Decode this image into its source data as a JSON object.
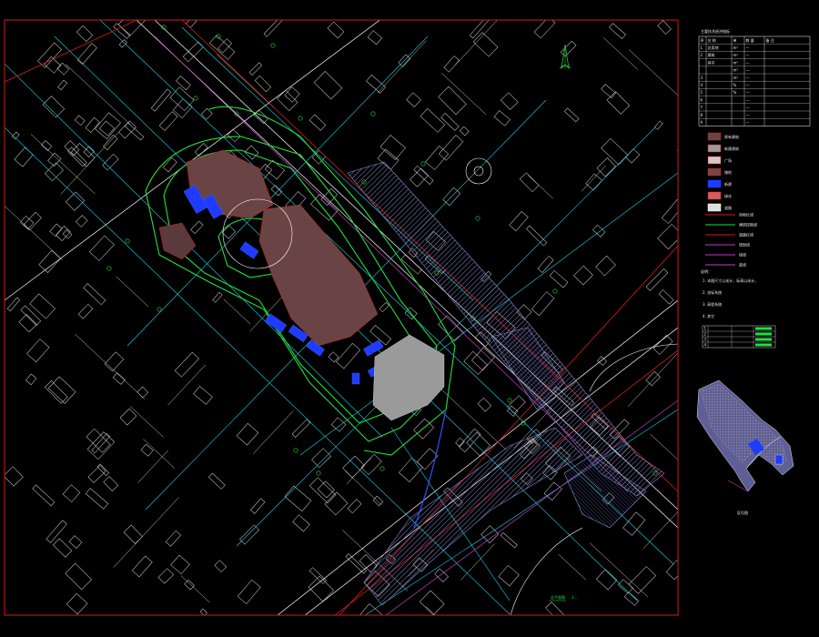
{
  "drawing": {
    "background": "#000000",
    "frame_color": "#d01c1c",
    "colors": {
      "building_lines": "#ffffff",
      "road_lines": "#ffffff",
      "cyan_grid": "#19d3e8",
      "green_boundary": "#20e040",
      "existing_building_fill": "#6a4444",
      "new_building_fill": "#1f3bff",
      "plaza_fill": "#9a9a9a",
      "hatch_color": "#7a7ab8",
      "magenta_line": "#c040c0",
      "red_line": "#d01c1c",
      "north_arrow": "#20c040"
    },
    "north_arrow_icon": "north-arrow-icon",
    "main_plan_title": "总平面图",
    "main_plan_scale": "1:...",
    "inset_title": "区位图"
  },
  "legend_panel": {
    "title": "主要技术经济指标",
    "table_headers": [
      "序",
      "名 称",
      "单",
      "数 量",
      "备 注"
    ],
    "table_rows": [
      [
        "1",
        "总用地",
        "m²",
        "—",
        ""
      ],
      [
        "2",
        "建筑",
        "m²",
        "—",
        ""
      ],
      [
        "",
        "其中",
        "m²",
        "—",
        ""
      ],
      [
        "",
        "",
        "m²",
        "—",
        ""
      ],
      [
        "3",
        "",
        "m²",
        "—",
        ""
      ],
      [
        "4",
        "",
        "%",
        "—",
        ""
      ],
      [
        "5",
        "",
        "%",
        "—",
        ""
      ],
      [
        "6",
        "",
        "",
        "—",
        ""
      ],
      [
        "7",
        "",
        "",
        "—",
        ""
      ],
      [
        "8",
        "",
        "",
        "—",
        ""
      ],
      [
        "9",
        "",
        "",
        "—",
        ""
      ]
    ],
    "symbols": [
      {
        "label": "原有建筑",
        "swatch": "#6a4444",
        "outline": "#d01c1c"
      },
      {
        "label": "新建建筑",
        "swatch": "#9a9a9a",
        "outline": "#d01c1c"
      },
      {
        "label": "广场",
        "swatch": "#d9c8c8",
        "outline": "#d01c1c"
      },
      {
        "label": "铺地",
        "swatch": "#7a4444",
        "outline": "#d01c1c"
      },
      {
        "label": "新建",
        "swatch": "#1f3bff",
        "outline": "#1f3bff"
      },
      {
        "label": "绿化",
        "swatch": "#d06060",
        "outline": "#d01c1c"
      },
      {
        "label": "道路",
        "swatch": "#dddddd",
        "outline": "#ffffff"
      }
    ],
    "line_legend": [
      {
        "label": "用地红线",
        "color": "#d01c1c"
      },
      {
        "label": "建筑控制线",
        "color": "#20e040"
      },
      {
        "label": "道路红线",
        "color": "#d01c1c"
      },
      {
        "label": "规划线",
        "color": "#c040c0"
      },
      {
        "label": "绿线",
        "color": "#c040c0"
      },
      {
        "label": "蓝线",
        "color": "#c040c0"
      }
    ],
    "notes_title": "说明：",
    "notes": [
      "1. 本图尺寸以米计，标高以米计。",
      "2. 坐标系统",
      "3. 高程系统",
      "4. 其它"
    ],
    "small_table_rows": [
      [
        "1",
        "",
        ""
      ],
      [
        "2",
        "",
        ""
      ],
      [
        "3",
        "",
        ""
      ],
      [
        "4",
        "",
        ""
      ]
    ]
  }
}
